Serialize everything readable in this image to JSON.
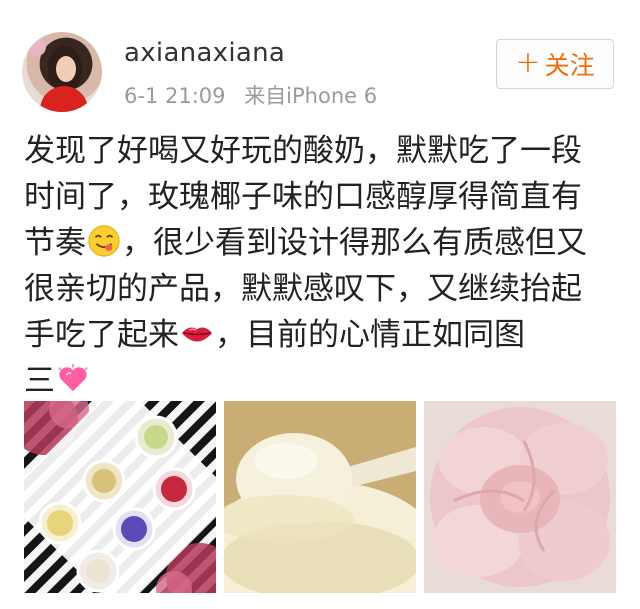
{
  "user": {
    "username": "axianaxiana",
    "time": "6-1 21:09",
    "source": "来自iPhone 6"
  },
  "follow": {
    "label": "关注",
    "plus": "+"
  },
  "post": {
    "lines": [
      "发现了好喝又好玩的酸奶，默默吃了一段",
      "时间了，玫瑰椰子味的口感醇厚得简直有",
      [
        "节奏",
        "，很少看到设计得那么有质感但又"
      ],
      "很亲切的产品，默默感叹下，又继续抬起",
      [
        "手吃了起来",
        "，目前的心情正如同图"
      ],
      [
        "三",
        ""
      ]
    ]
  },
  "icons": {
    "emoji_1": "yummy-face-emoji-icon",
    "emoji_2": "lips-emoji-icon",
    "emoji_3": "sparkling-heart-emoji-icon"
  },
  "colors": {
    "accent": "#f06c0c",
    "text": "#222222",
    "meta": "#9a9a9a"
  }
}
